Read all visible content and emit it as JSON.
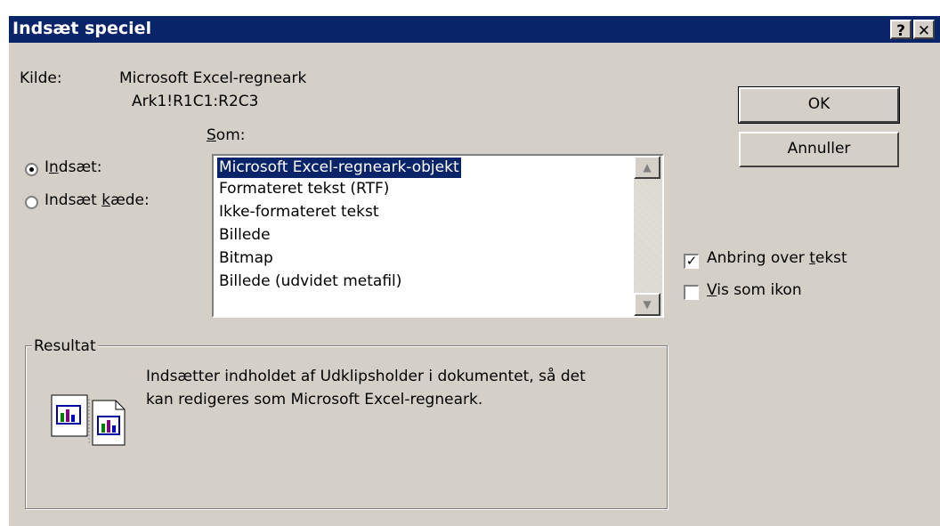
{
  "window": {
    "title": "Indsæt speciel",
    "help_button": "?",
    "close_button": "✕"
  },
  "source": {
    "label": "Kilde:",
    "line1": "Microsoft Excel-regneark",
    "line2": "Ark1!R1C1:R2C3"
  },
  "as_label": "Som:",
  "options": {
    "paste_label": "Indsæt:",
    "paste_selected": true,
    "paste_link_label": "Indsæt kæde:",
    "paste_link_selected": false
  },
  "formats": [
    {
      "label": "Microsoft Excel-regneark-objekt",
      "selected": true
    },
    {
      "label": "Formateret tekst (RTF)",
      "selected": false
    },
    {
      "label": "Ikke-formateret tekst",
      "selected": false
    },
    {
      "label": "Billede",
      "selected": false
    },
    {
      "label": "Bitmap",
      "selected": false
    },
    {
      "label": "Billede (udvidet metafil)",
      "selected": false
    }
  ],
  "buttons": {
    "ok": "OK",
    "cancel": "Annuller"
  },
  "checkboxes": {
    "float_over_text": {
      "label": "Anbring over tekst",
      "checked": true
    },
    "display_as_icon": {
      "label": "Vis som ikon",
      "checked": false
    }
  },
  "result": {
    "legend": "Resultat",
    "line1": "Indsætter indholdet af Udklipsholder i dokumentet, så det",
    "line2": "kan redigeres som Microsoft Excel-regneark.",
    "icon": "paste-result-icon"
  },
  "colors": {
    "titlebar": "#0a246a",
    "dialog_bg": "#d4d0c8",
    "selection": "#0a246a"
  }
}
